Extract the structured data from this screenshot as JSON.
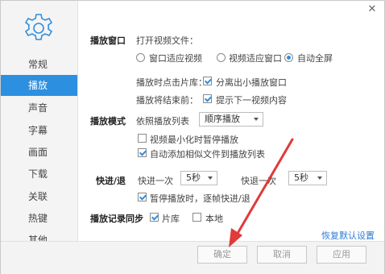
{
  "sidebar": {
    "items": [
      {
        "label": "常规"
      },
      {
        "label": "播放"
      },
      {
        "label": "声音"
      },
      {
        "label": "字幕"
      },
      {
        "label": "画面"
      },
      {
        "label": "下载"
      },
      {
        "label": "关联"
      },
      {
        "label": "热键"
      },
      {
        "label": "其他"
      }
    ],
    "active_index": 1
  },
  "playback_window": {
    "section": "播放窗口",
    "open_file_label": "打开视频文件：",
    "options": [
      "窗口适应视频",
      "视频适应窗口",
      "自动全屏"
    ],
    "selected": "自动全屏",
    "library_label": "播放时点击片库：",
    "library_option": "分离出小播放窗口",
    "library_checked": true,
    "end_label": "播放将结束前：",
    "end_option": "提示下一视频内容",
    "end_checked": true
  },
  "play_mode": {
    "section": "播放模式",
    "order_label": "依照播放列表",
    "order_value": "顺序播放",
    "pause_min_label": "视频最小化时暂停播放",
    "pause_min_checked": false,
    "auto_add_label": "自动添加相似文件到播放列表",
    "auto_add_checked": true
  },
  "seek": {
    "section": "快进/退",
    "forward_label": "快进一次",
    "forward_value": "5秒",
    "backward_label": "快退一次",
    "backward_value": "5秒",
    "pause_frame_label": "暂停播放时，逐帧快进/退",
    "pause_frame_checked": true
  },
  "sync": {
    "section": "播放记录同步",
    "library_label": "片库",
    "library_checked": true,
    "local_label": "本地",
    "local_checked": false
  },
  "footer": {
    "restore_defaults": "恢复默认设置",
    "ok": "确定",
    "cancel": "取消",
    "apply": "应用"
  },
  "colors": {
    "accent": "#2d8fe0",
    "arrow": "#e03a3a"
  }
}
